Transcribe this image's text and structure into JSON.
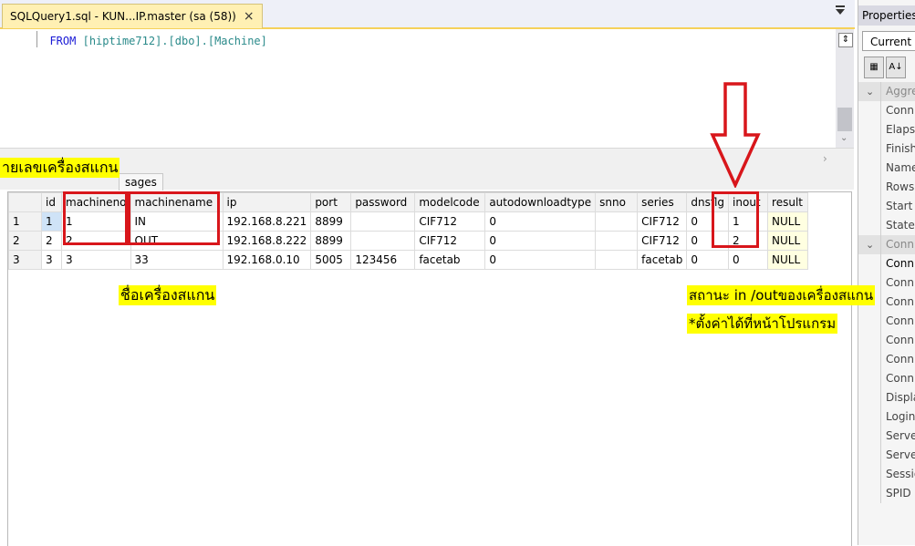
{
  "document_tab": {
    "title": "SQLQuery1.sql - KUN...IP.master (sa (58))",
    "close_glyph": "×"
  },
  "editor": {
    "keyword": "FROM",
    "object": "[hiptime712].[dbo].[Machine]"
  },
  "results": {
    "tab_label": "sages",
    "columns": [
      "",
      "id",
      "machineno",
      "machinename",
      "ip",
      "port",
      "password",
      "modelcode",
      "autodownloadtype",
      "snno",
      "series",
      "dnsflg",
      "inout",
      "result"
    ],
    "rows": [
      [
        "1",
        "1",
        "1",
        "IN",
        "192.168.8.221",
        "8899",
        "",
        "CIF712",
        "0",
        "",
        "CIF712",
        "0",
        "1",
        "NULL"
      ],
      [
        "2",
        "2",
        "2",
        "OUT",
        "192.168.8.222",
        "8899",
        "",
        "CIF712",
        "0",
        "",
        "CIF712",
        "0",
        "2",
        "NULL"
      ],
      [
        "3",
        "3",
        "3",
        "33",
        "192.168.0.10",
        "5005",
        "123456",
        "facetab",
        "0",
        "",
        "facetab",
        "0",
        "0",
        "NULL"
      ]
    ]
  },
  "properties": {
    "title": "Properties",
    "current": "Current c",
    "cat1": "Aggre",
    "items1": [
      "Conn",
      "Elapse",
      "Finish",
      "Name",
      "Rows",
      "Start t",
      "State"
    ],
    "cat2": "Conn",
    "items2": [
      "Conn",
      "Conn",
      "Conn",
      "Conn",
      "Conn",
      "Conn",
      "Conn",
      "Displa",
      "Login",
      "Serve",
      "Serve",
      "Sessio",
      "SPID"
    ]
  },
  "annotations": {
    "machineno_note": "ายเลขเครื่องสแกน",
    "machinename_note": "ชื่อเครื่องสแกน",
    "inout_note_line1": "สถานะ in /outของเครื่องสแกน",
    "inout_note_line2": "*ตั้งค่าได้ที่หน้าโปรแกรม"
  },
  "colors": {
    "annotation_bg": "#ffff00",
    "annotation_border": "#d8161b",
    "tab_accent": "#f5d15a"
  }
}
